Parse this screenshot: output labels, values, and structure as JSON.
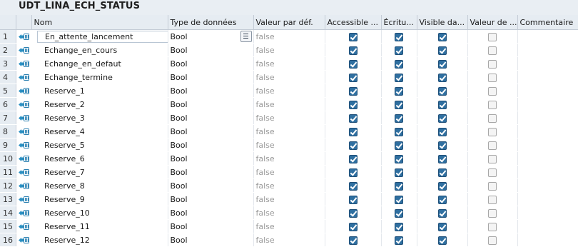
{
  "title": "UDT_LINA_ECH_STATUS",
  "columns": {
    "name": "Nom",
    "type": "Type de données",
    "default": "Valeur par déf.",
    "accessible": "Accessible ...",
    "write": "Écritu...",
    "visible": "Visible da...",
    "setpoint": "Valeur de ...",
    "comment": "Commentaire"
  },
  "rows": [
    {
      "num": "1",
      "name": "En_attente_lancement",
      "type": "Bool",
      "default": "false",
      "accessible": true,
      "write": true,
      "visible": true,
      "setpoint": false,
      "comment": ""
    },
    {
      "num": "2",
      "name": "Echange_en_cours",
      "type": "Bool",
      "default": "false",
      "accessible": true,
      "write": true,
      "visible": true,
      "setpoint": false,
      "comment": ""
    },
    {
      "num": "3",
      "name": "Echange_en_defaut",
      "type": "Bool",
      "default": "false",
      "accessible": true,
      "write": true,
      "visible": true,
      "setpoint": false,
      "comment": ""
    },
    {
      "num": "4",
      "name": "Echange_termine",
      "type": "Bool",
      "default": "false",
      "accessible": true,
      "write": true,
      "visible": true,
      "setpoint": false,
      "comment": ""
    },
    {
      "num": "5",
      "name": "Reserve_1",
      "type": "Bool",
      "default": "false",
      "accessible": true,
      "write": true,
      "visible": true,
      "setpoint": false,
      "comment": ""
    },
    {
      "num": "6",
      "name": "Reserve_2",
      "type": "Bool",
      "default": "false",
      "accessible": true,
      "write": true,
      "visible": true,
      "setpoint": false,
      "comment": ""
    },
    {
      "num": "7",
      "name": "Reserve_3",
      "type": "Bool",
      "default": "false",
      "accessible": true,
      "write": true,
      "visible": true,
      "setpoint": false,
      "comment": ""
    },
    {
      "num": "8",
      "name": "Reserve_4",
      "type": "Bool",
      "default": "false",
      "accessible": true,
      "write": true,
      "visible": true,
      "setpoint": false,
      "comment": ""
    },
    {
      "num": "9",
      "name": "Reserve_5",
      "type": "Bool",
      "default": "false",
      "accessible": true,
      "write": true,
      "visible": true,
      "setpoint": false,
      "comment": ""
    },
    {
      "num": "10",
      "name": "Reserve_6",
      "type": "Bool",
      "default": "false",
      "accessible": true,
      "write": true,
      "visible": true,
      "setpoint": false,
      "comment": ""
    },
    {
      "num": "11",
      "name": "Reserve_7",
      "type": "Bool",
      "default": "false",
      "accessible": true,
      "write": true,
      "visible": true,
      "setpoint": false,
      "comment": ""
    },
    {
      "num": "12",
      "name": "Reserve_8",
      "type": "Bool",
      "default": "false",
      "accessible": true,
      "write": true,
      "visible": true,
      "setpoint": false,
      "comment": ""
    },
    {
      "num": "13",
      "name": "Reserve_9",
      "type": "Bool",
      "default": "false",
      "accessible": true,
      "write": true,
      "visible": true,
      "setpoint": false,
      "comment": ""
    },
    {
      "num": "14",
      "name": "Reserve_10",
      "type": "Bool",
      "default": "false",
      "accessible": true,
      "write": true,
      "visible": true,
      "setpoint": false,
      "comment": ""
    },
    {
      "num": "15",
      "name": "Reserve_11",
      "type": "Bool",
      "default": "false",
      "accessible": true,
      "write": true,
      "visible": true,
      "setpoint": false,
      "comment": ""
    },
    {
      "num": "16",
      "name": "Reserve_12",
      "type": "Bool",
      "default": "false",
      "accessible": true,
      "write": true,
      "visible": true,
      "setpoint": false,
      "comment": ""
    }
  ],
  "icons": {
    "member": "member-icon",
    "type_dropdown": "list-dropdown-icon"
  },
  "colors": {
    "checkbox_on": "#2f6fa0",
    "checkbox_off": "#f4f4f4",
    "header_bg": "#e6ecf2",
    "default_value_text": "#9a9a9a"
  }
}
